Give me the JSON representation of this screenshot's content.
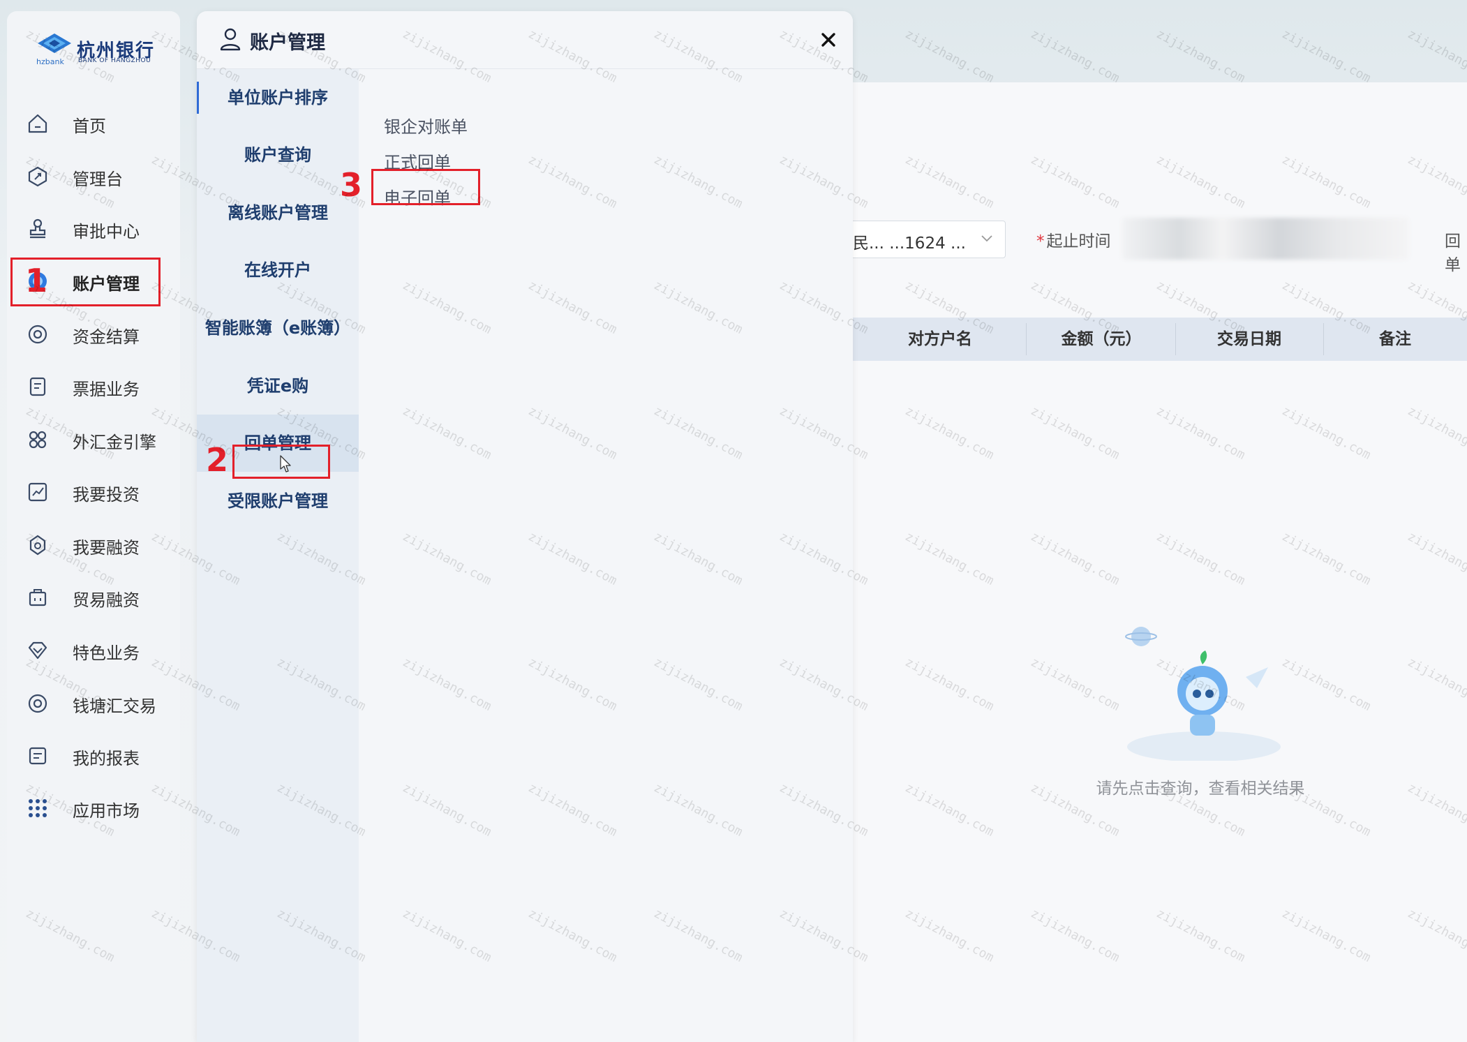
{
  "brand": {
    "name_cn": "杭州银行",
    "name_en": "BANK OF HANGZHOU",
    "short": "hzbank"
  },
  "sidebar": {
    "items": [
      {
        "label": "首页",
        "icon": "home-icon"
      },
      {
        "label": "管理台",
        "icon": "dashboard-icon"
      },
      {
        "label": "审批中心",
        "icon": "stamp-icon"
      },
      {
        "label": "账户管理",
        "icon": "account-icon",
        "active": true
      },
      {
        "label": "资金结算",
        "icon": "settlement-icon"
      },
      {
        "label": "票据业务",
        "icon": "bill-icon"
      },
      {
        "label": "外汇金引擎",
        "icon": "forex-icon"
      },
      {
        "label": "我要投资",
        "icon": "invest-chart-icon"
      },
      {
        "label": "我要融资",
        "icon": "financing-icon"
      },
      {
        "label": "贸易融资",
        "icon": "trade-icon"
      },
      {
        "label": "特色业务",
        "icon": "diamond-icon"
      },
      {
        "label": "钱塘汇交易",
        "icon": "trade-circle-icon"
      },
      {
        "label": "我的报表",
        "icon": "report-icon"
      },
      {
        "label": "应用市场",
        "icon": "grid-icon"
      }
    ]
  },
  "panel": {
    "title": "账户管理",
    "sub_items": [
      "单位账户排序",
      "账户查询",
      "离线账户管理",
      "在线开户",
      "智能账簿（e账簿）",
      "凭证e购",
      "回单管理",
      "受限账户管理"
    ],
    "leaf_items": [
      "银企对账单",
      "正式回单",
      "电子回单"
    ]
  },
  "steps": [
    "1",
    "2",
    "3"
  ],
  "main": {
    "account_select_value": "民... ...1624 ...",
    "date_label": "起止时间",
    "date_required_mark": "*",
    "next_label": "回单",
    "table_headers": [
      "对方户名",
      "金额（元）",
      "交易日期",
      "备注"
    ],
    "empty_text": "请先点击查询，查看相关结果"
  },
  "watermark": "zijizhang.com",
  "colors": {
    "highlight_red": "#e3202a",
    "nav_text": "#1f3e6e",
    "accent_blue": "#2f6bd6"
  }
}
